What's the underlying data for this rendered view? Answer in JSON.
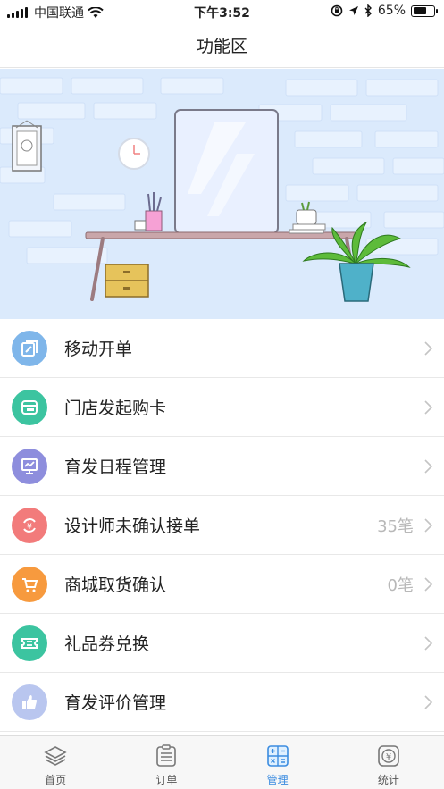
{
  "status_bar": {
    "carrier": "中国联通",
    "time": "下午3:52",
    "battery_percent": "65%",
    "battery_level": 0.65
  },
  "nav": {
    "title": "功能区"
  },
  "menu": [
    {
      "label": "移动开单",
      "count": "",
      "color": "#7fb6ea",
      "icon": "edit-order-icon"
    },
    {
      "label": "门店发起购卡",
      "count": "",
      "color": "#3cc4a0",
      "icon": "card-icon"
    },
    {
      "label": "育发日程管理",
      "count": "",
      "color": "#8e8edd",
      "icon": "schedule-board-icon"
    },
    {
      "label": "设计师未确认接单",
      "count": "35笔",
      "color": "#f27b7b",
      "icon": "yen-exchange-icon"
    },
    {
      "label": "商城取货确认",
      "count": "0笔",
      "color": "#f79a3e",
      "icon": "cart-icon"
    },
    {
      "label": "礼品券兑换",
      "count": "",
      "color": "#3cc4a0",
      "icon": "ticket-icon"
    },
    {
      "label": "育发评价管理",
      "count": "",
      "color": "#b9c6ef",
      "icon": "thumbs-up-icon"
    }
  ],
  "tabs": [
    {
      "label": "首页",
      "icon": "layers-icon",
      "active": false
    },
    {
      "label": "订单",
      "icon": "clipboard-icon",
      "active": false
    },
    {
      "label": "管理",
      "icon": "calculator-icon",
      "active": true
    },
    {
      "label": "统计",
      "icon": "yen-icon",
      "active": false
    }
  ]
}
